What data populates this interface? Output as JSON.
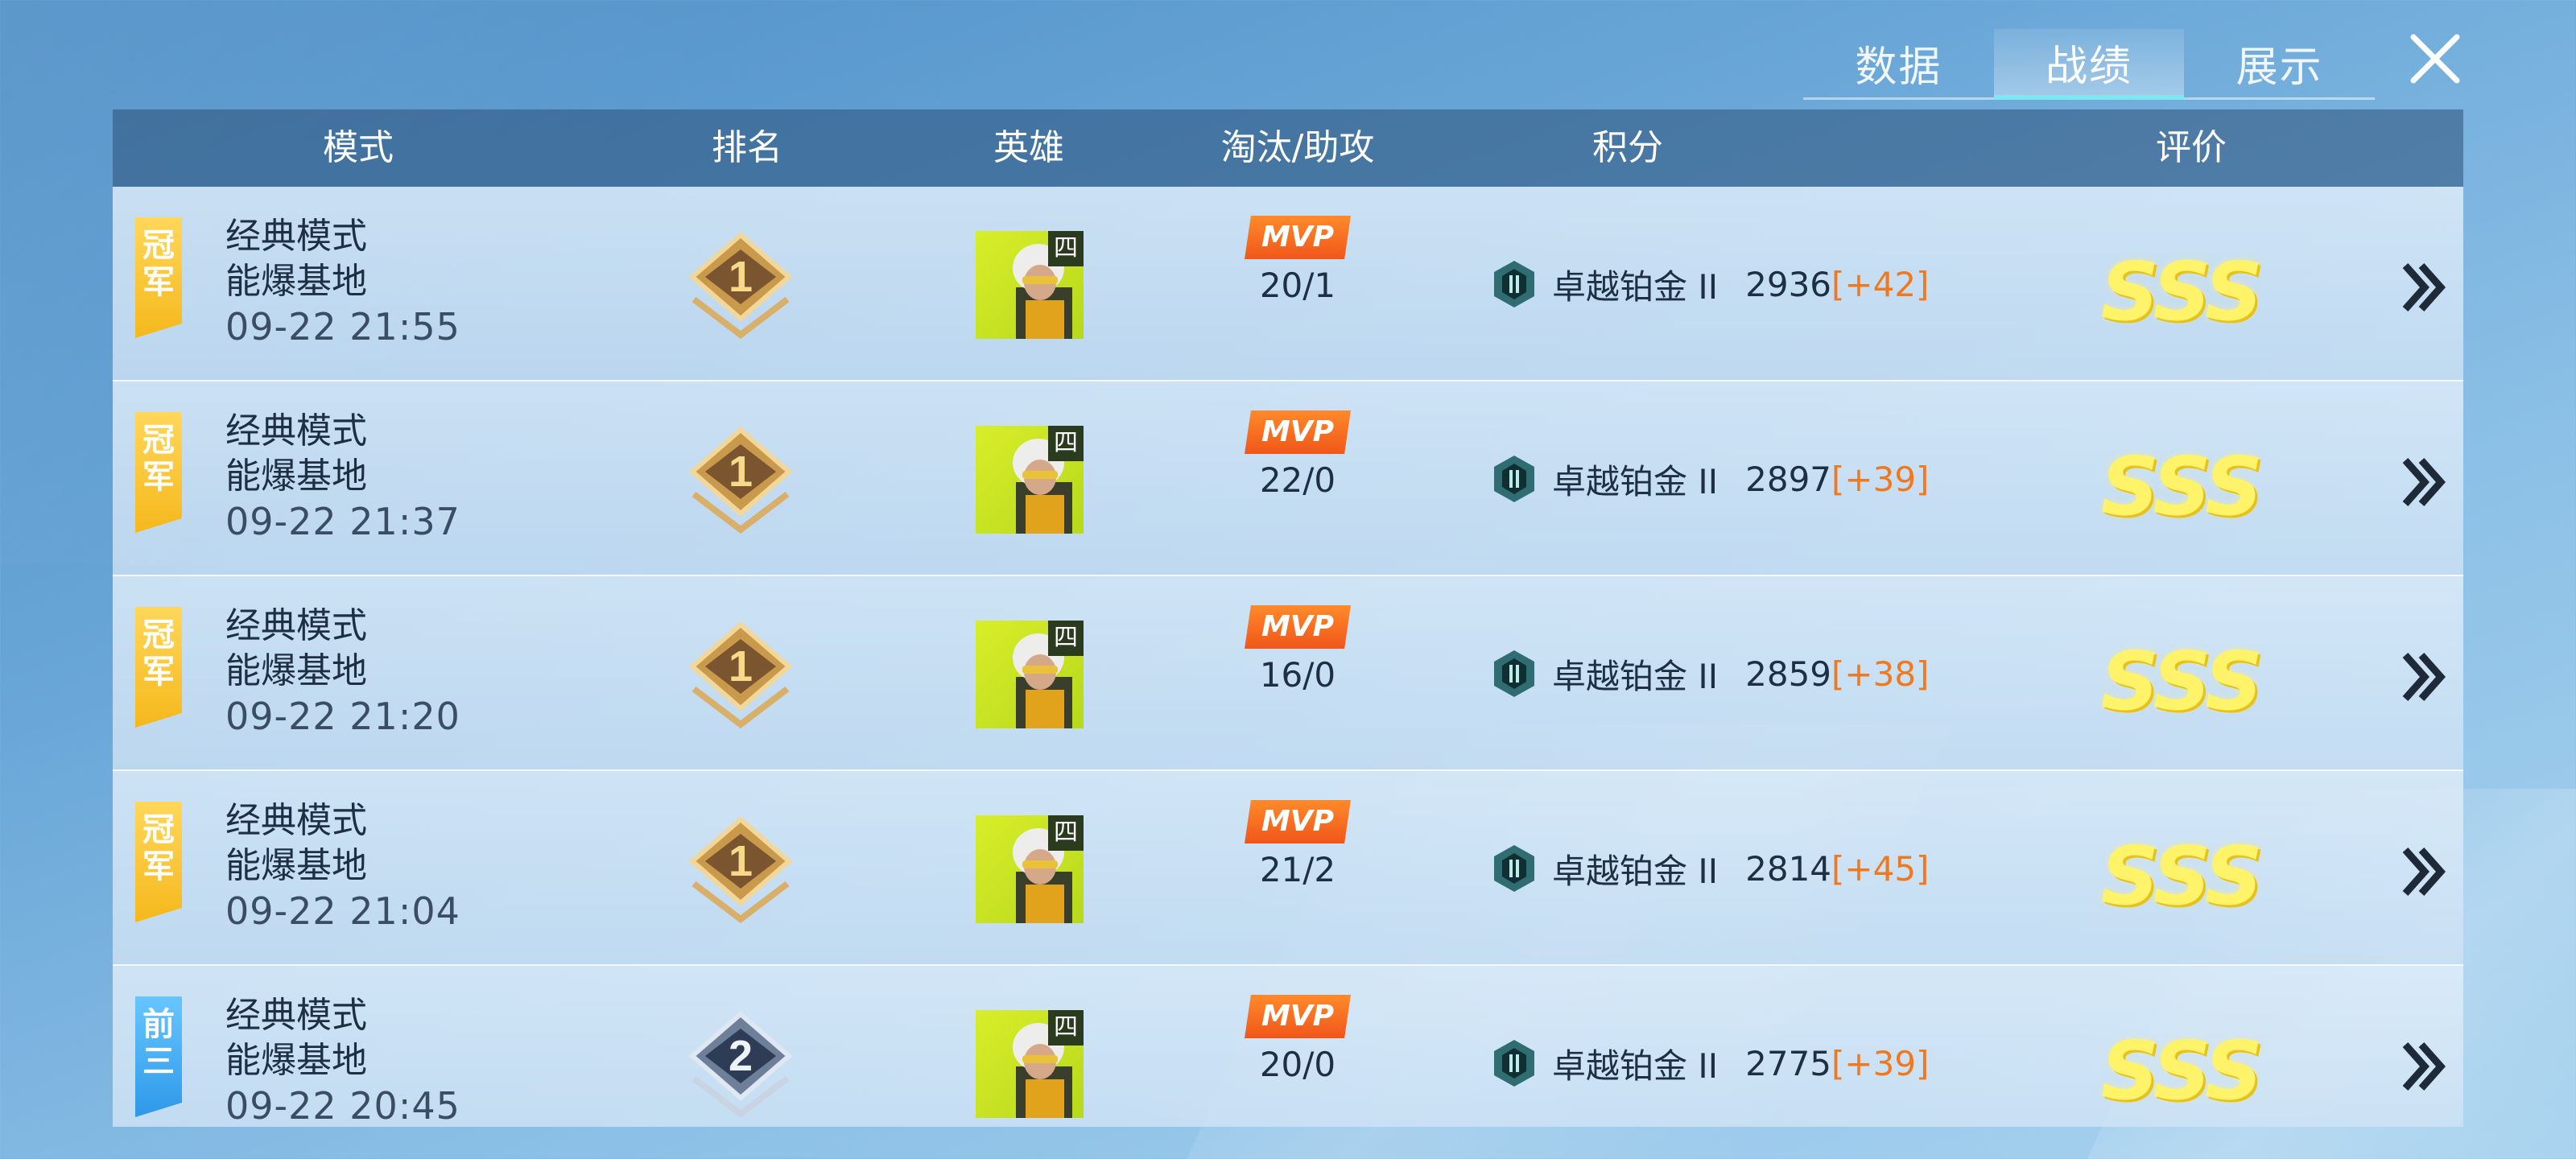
{
  "tabs": [
    {
      "label": "数据",
      "active": false
    },
    {
      "label": "战绩",
      "active": true
    },
    {
      "label": "展示",
      "active": false
    }
  ],
  "close_icon": "close-icon",
  "columns": [
    "模式",
    "排名",
    "英雄",
    "淘汰/助攻",
    "积分",
    "评价"
  ],
  "rows": [
    {
      "badge": "冠军",
      "badge_color": "#f5b81c",
      "mode": "经典模式",
      "map": "能爆基地",
      "time": "09-22 21:55",
      "rank": "1",
      "hero_tag": "四",
      "mvp": "MVP",
      "kda": "20/1",
      "tier": "卓越铂金 II",
      "points": "2936",
      "delta": "[+42]",
      "grade": "SSS"
    },
    {
      "badge": "冠军",
      "badge_color": "#f5b81c",
      "mode": "经典模式",
      "map": "能爆基地",
      "time": "09-22 21:37",
      "rank": "1",
      "hero_tag": "四",
      "mvp": "MVP",
      "kda": "22/0",
      "tier": "卓越铂金 II",
      "points": "2897",
      "delta": "[+39]",
      "grade": "SSS"
    },
    {
      "badge": "冠军",
      "badge_color": "#f5b81c",
      "mode": "经典模式",
      "map": "能爆基地",
      "time": "09-22 21:20",
      "rank": "1",
      "hero_tag": "四",
      "mvp": "MVP",
      "kda": "16/0",
      "tier": "卓越铂金 II",
      "points": "2859",
      "delta": "[+38]",
      "grade": "SSS"
    },
    {
      "badge": "冠军",
      "badge_color": "#f5b81c",
      "mode": "经典模式",
      "map": "能爆基地",
      "time": "09-22 21:04",
      "rank": "1",
      "hero_tag": "四",
      "mvp": "MVP",
      "kda": "21/2",
      "tier": "卓越铂金 II",
      "points": "2814",
      "delta": "[+45]",
      "grade": "SSS"
    },
    {
      "badge": "前三",
      "badge_color": "#2e98e8",
      "mode": "经典模式",
      "map": "能爆基地",
      "time": "09-22 20:45",
      "rank": "2",
      "hero_tag": "四",
      "mvp": "MVP",
      "kda": "20/0",
      "tier": "卓越铂金 II",
      "points": "2775",
      "delta": "[+39]",
      "grade": "SSS"
    }
  ]
}
